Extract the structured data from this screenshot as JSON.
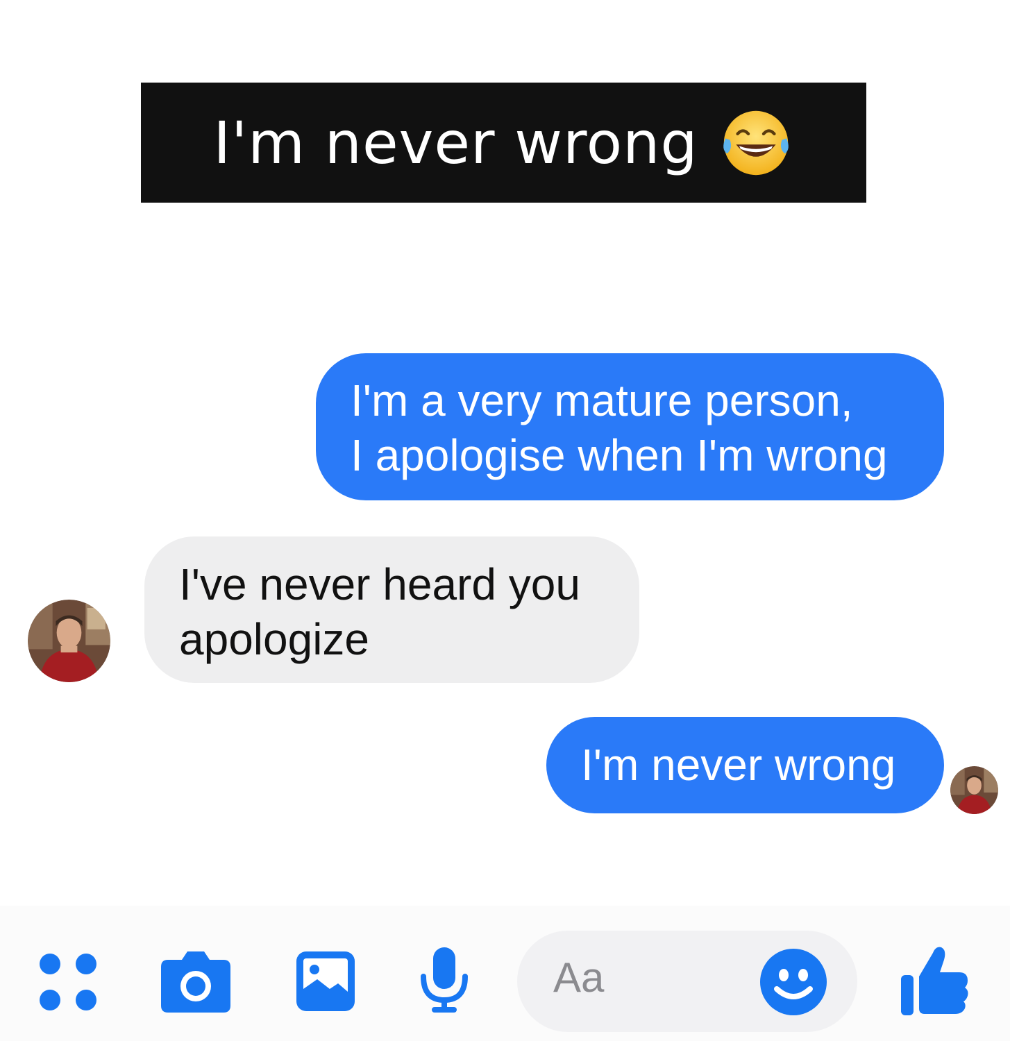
{
  "caption": {
    "text": "I'm never wrong",
    "emoji": "face-with-tears-of-joy"
  },
  "messages": [
    {
      "direction": "outgoing",
      "lines": [
        "I'm a very mature person,",
        "I apologise when I'm wrong"
      ]
    },
    {
      "direction": "incoming",
      "lines": [
        "I've never heard you",
        "apologize"
      ]
    },
    {
      "direction": "outgoing",
      "lines": [
        "I'm never wrong"
      ]
    }
  ],
  "composer": {
    "placeholder": "Aa",
    "icons": [
      "apps-icon",
      "camera-icon",
      "gallery-icon",
      "microphone-icon",
      "emoji-icon",
      "thumbs-up-icon"
    ]
  },
  "colors": {
    "outgoing_bubble": "#2a7af8",
    "incoming_bubble": "#eeeeef",
    "accent": "#1877f2",
    "caption_background": "#111111"
  }
}
